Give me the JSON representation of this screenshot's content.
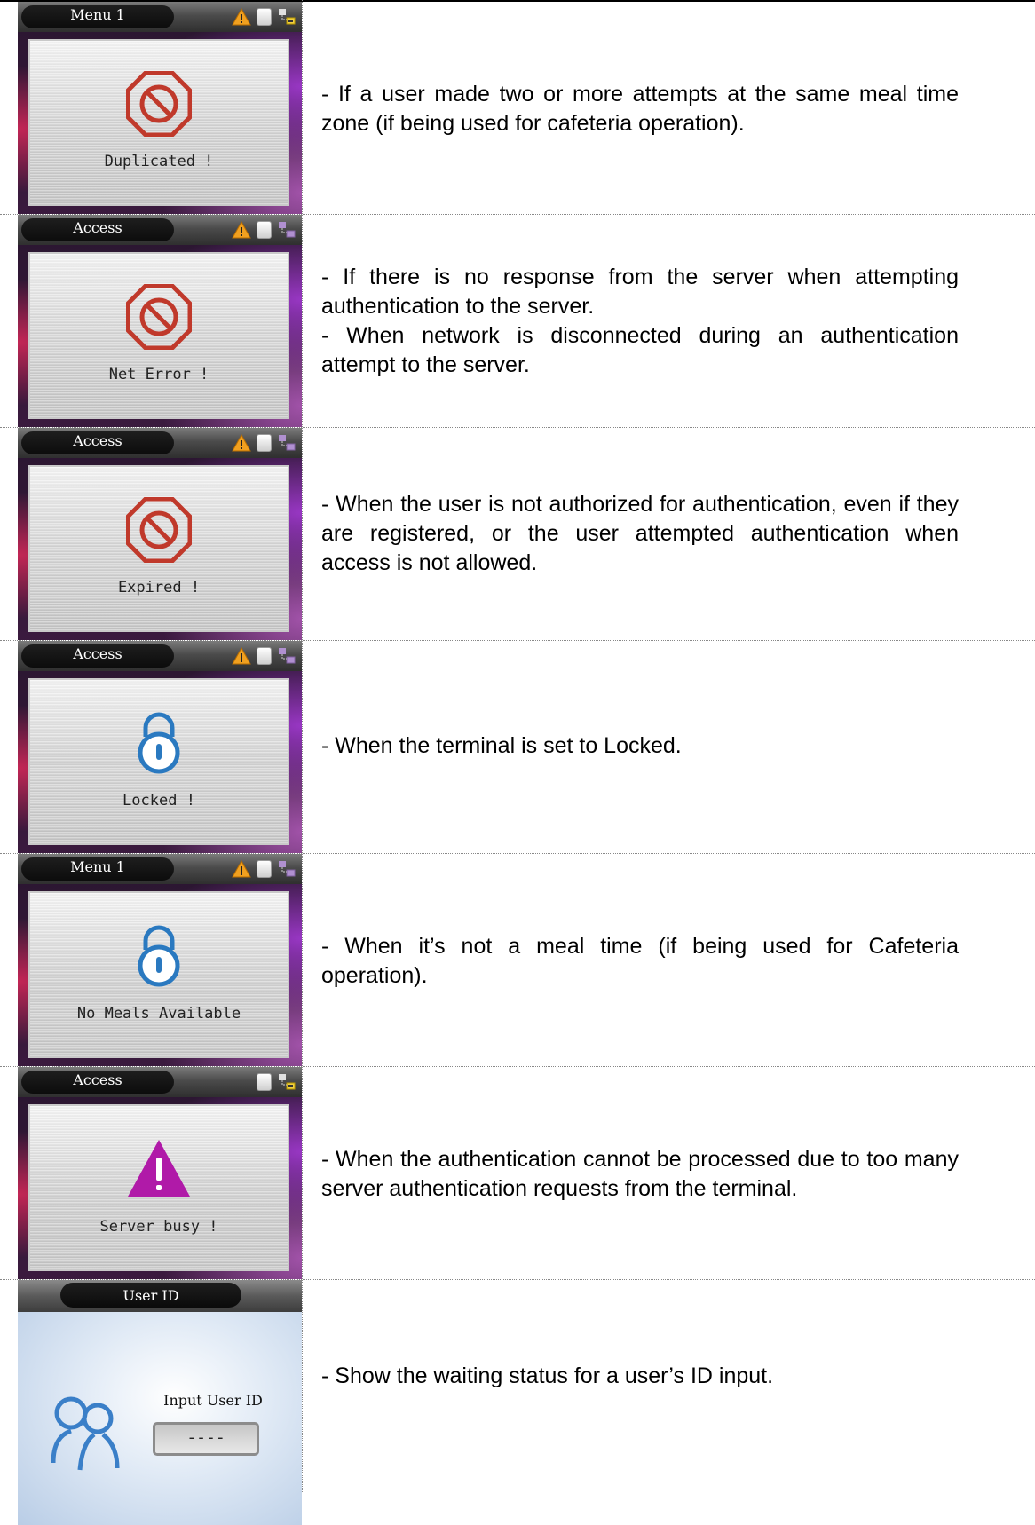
{
  "rows": [
    {
      "screen_title": "Menu 1",
      "panel_icon": "stop-prohibited-icon",
      "message": "Duplicated !",
      "status_icons": [
        "warning-icon",
        "card-icon",
        "network-icon"
      ],
      "description": [
        "- If a user made two or more attempts at the same meal time zone (if being used for cafeteria operation)."
      ]
    },
    {
      "screen_title": "Access",
      "panel_icon": "stop-prohibited-icon",
      "message": "Net Error !",
      "status_icons": [
        "warning-icon",
        "card-icon",
        "network-icon"
      ],
      "description": [
        "- If there is no response from the server when attempting authentication to the server.",
        "- When network is disconnected during an authentication attempt to the server."
      ]
    },
    {
      "screen_title": "Access",
      "panel_icon": "stop-prohibited-icon",
      "message": "Expired !",
      "status_icons": [
        "warning-icon",
        "card-icon",
        "network-icon"
      ],
      "description": [
        "- When the user is not authorized for authentication, even if they are registered, or the user attempted authentication when access is not allowed."
      ]
    },
    {
      "screen_title": "Access",
      "panel_icon": "lock-icon",
      "message": "Locked !",
      "status_icons": [
        "warning-icon",
        "card-icon",
        "network-icon"
      ],
      "description": [
        "- When the terminal is set to Locked."
      ]
    },
    {
      "screen_title": "Menu 1",
      "panel_icon": "lock-icon",
      "message": "No Meals Available",
      "status_icons": [
        "warning-icon",
        "card-icon",
        "network-icon"
      ],
      "description": [
        "- When it’s not a meal time (if being used for Cafeteria operation)."
      ]
    },
    {
      "screen_title": "Access",
      "panel_icon": "warning-triangle-icon",
      "message": "Server busy !",
      "status_icons": [
        "card-icon",
        "network-icon"
      ],
      "description": [
        "- When the authentication cannot be processed due to too many server authentication requests from the terminal."
      ]
    },
    {
      "screen_title": "User ID",
      "panel_icon": "users-icon",
      "input_label": "Input User ID",
      "input_value": "----",
      "description": [
        "- Show the waiting status for a user’s ID input."
      ]
    }
  ],
  "colors": {
    "stop_red": "#c0392b",
    "lock_blue": "#2a79c0",
    "warn_purple": "#b01aa8",
    "warn_orange": "#f0a020"
  }
}
